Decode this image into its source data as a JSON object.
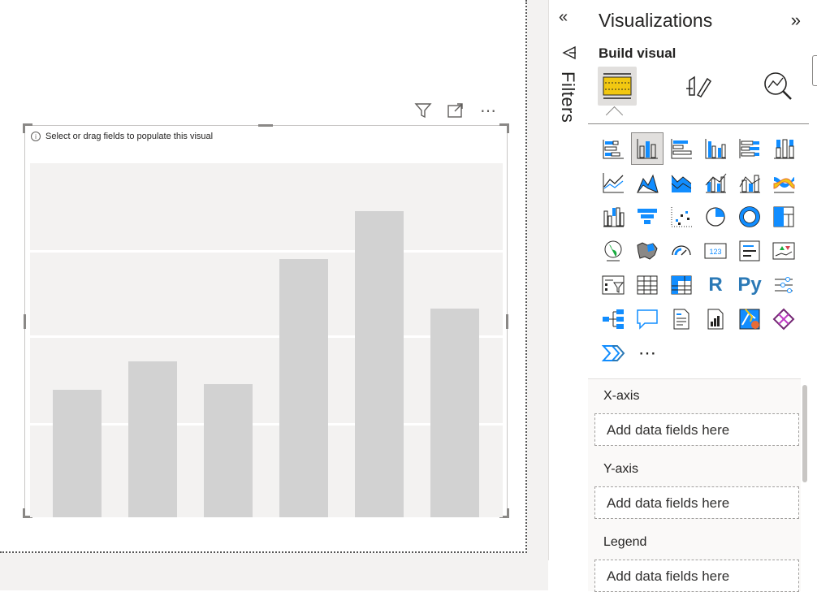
{
  "canvas": {
    "visual_message": "Select or drag fields to populate this visual",
    "placeholder_bars": [
      0.36,
      0.44,
      0.375,
      0.73,
      0.865,
      0.59
    ],
    "colors": {
      "bar": "#d2d2d2",
      "plot_bg": "#f3f2f1"
    }
  },
  "visual_header": {
    "filter_icon": "filter-icon",
    "focus_icon": "focus-mode-icon",
    "more_icon": "more-options-icon",
    "more_glyph": "⋯"
  },
  "filters": {
    "label": "Filters",
    "collapse_glyph": "«"
  },
  "visualizations": {
    "title": "Visualizations",
    "expand_glyph": "»",
    "build_label": "Build visual",
    "tabs": [
      "build-visual-icon",
      "format-visual-icon",
      "analytics-icon"
    ],
    "more_glyph": "⋯",
    "icons": [
      "stacked-bar-chart-icon",
      "stacked-column-chart-icon",
      "clustered-bar-chart-icon",
      "clustered-column-chart-icon",
      "100-stacked-bar-chart-icon",
      "100-stacked-column-chart-icon",
      "line-chart-icon",
      "area-chart-icon",
      "stacked-area-chart-icon",
      "line-clustered-column-icon",
      "line-stacked-column-icon",
      "ribbon-chart-icon",
      "waterfall-chart-icon",
      "funnel-icon",
      "scatter-chart-icon",
      "pie-chart-icon",
      "donut-chart-icon",
      "treemap-icon",
      "map-icon",
      "filled-map-icon",
      "gauge-icon",
      "card-icon",
      "multi-row-card-icon",
      "kpi-icon",
      "slicer-icon",
      "table-icon",
      "matrix-icon",
      "r-visual-icon",
      "python-visual-icon",
      "key-influencers-icon",
      "decomposition-tree-icon",
      "qna-icon",
      "smart-narrative-icon",
      "paginated-report-icon",
      "azure-map-icon",
      "power-apps-icon",
      "power-automate-icon"
    ],
    "r_label": "R",
    "py_label": "Py",
    "card_label": "123"
  },
  "wells": [
    {
      "label": "X-axis",
      "placeholder": "Add data fields here"
    },
    {
      "label": "Y-axis",
      "placeholder": "Add data fields here"
    },
    {
      "label": "Legend",
      "placeholder": "Add data fields here"
    }
  ]
}
